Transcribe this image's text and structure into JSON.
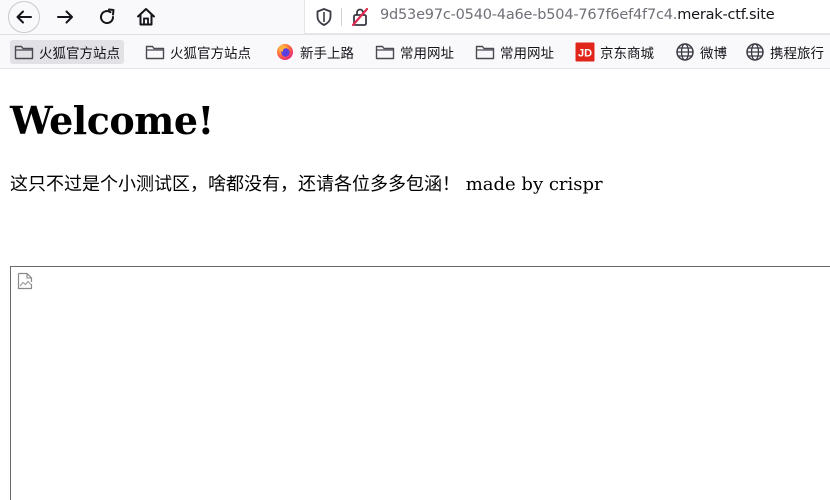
{
  "toolbar": {
    "back_icon": "back-arrow-icon",
    "forward_icon": "forward-arrow-icon",
    "reload_icon": "reload-icon",
    "home_icon": "home-icon"
  },
  "urlbar": {
    "shield_icon": "tracking-shield-icon",
    "security_icon": "insecure-lock-icon",
    "url_subdomain": "9d53e97c-0540-4a6e-b504-767f6ef4f7c4.",
    "url_domain": "merak-ctf.site"
  },
  "bookmarks": [
    {
      "label": "火狐官方站点",
      "icon": "folder-icon"
    },
    {
      "label": "火狐官方站点",
      "icon": "folder-icon"
    },
    {
      "label": "新手上路",
      "icon": "firefox-icon"
    },
    {
      "label": "常用网址",
      "icon": "folder-icon"
    },
    {
      "label": "常用网址",
      "icon": "folder-icon"
    },
    {
      "label": "京东商城",
      "icon": "jd-icon"
    },
    {
      "label": "微博",
      "icon": "globe-icon"
    },
    {
      "label": "携程旅行",
      "icon": "globe-icon"
    }
  ],
  "page": {
    "title": "Welcome!",
    "text": "这只不过是个小测试区，啥都没有，还请各位多多包涵！ made by crispr",
    "broken_image_icon": "broken-image-icon"
  },
  "colors": {
    "jd_red": "#e1251b",
    "firefox_orange": "#ff7139",
    "toolbar_bg": "#f9f9fb"
  }
}
